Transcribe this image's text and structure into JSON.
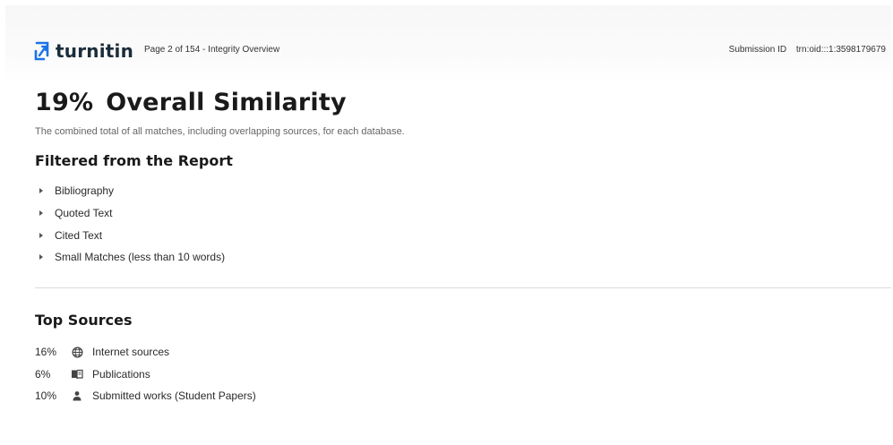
{
  "header": {
    "logo_text": "turnitin",
    "page_info": "Page 2 of 154 - Integrity Overview",
    "submission_label": "Submission ID",
    "submission_id": "trn:oid:::1:3598179679"
  },
  "overview": {
    "similarity_percent": "19%",
    "title": "Overall Similarity",
    "description": "The combined total of all matches, including overlapping sources, for each database."
  },
  "filtered": {
    "heading": "Filtered from the Report",
    "items": [
      "Bibliography",
      "Quoted Text",
      "Cited Text",
      "Small Matches (less than 10 words)"
    ]
  },
  "top_sources": {
    "heading": "Top Sources",
    "items": [
      {
        "percent": "16%",
        "icon": "globe-icon",
        "label": "Internet sources"
      },
      {
        "percent": "6%",
        "icon": "book-icon",
        "label": "Publications"
      },
      {
        "percent": "10%",
        "icon": "person-icon",
        "label": "Submitted works (Student Papers)"
      }
    ]
  },
  "colors": {
    "logo_blue": "#1a73e8",
    "logo_text": "#1b2d3a",
    "body_text": "#2a2a2a",
    "muted_text": "#666666",
    "divider": "#dcdcdc"
  }
}
